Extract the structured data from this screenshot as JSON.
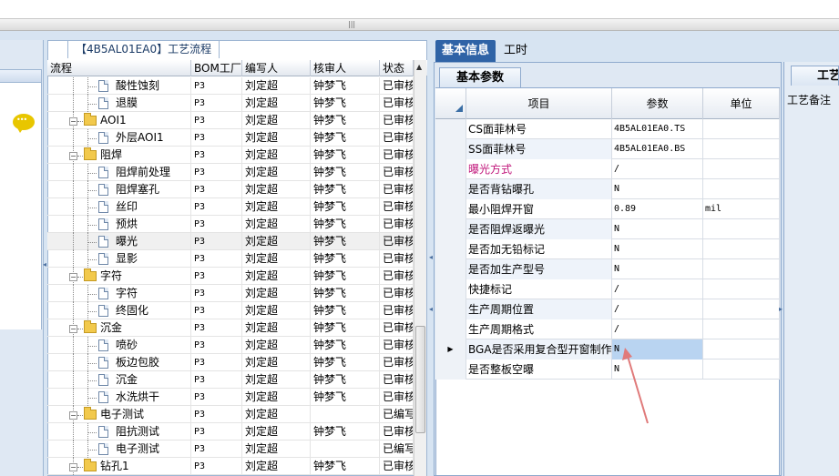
{
  "process_panel": {
    "title": "【4B5AL01EA0】工艺流程",
    "columns": [
      "流程",
      "BOM工厂",
      "编写人",
      "核审人",
      "状态"
    ],
    "rows": [
      {
        "level": 2,
        "type": "file",
        "label": "酸性蚀刻",
        "bom": "P3",
        "writer": "刘定超",
        "reviewer": "钟梦飞",
        "status": "已审核"
      },
      {
        "level": 2,
        "type": "file",
        "label": "退膜",
        "bom": "P3",
        "writer": "刘定超",
        "reviewer": "钟梦飞",
        "status": "已审核"
      },
      {
        "level": 1,
        "type": "folder",
        "label": "AOI1",
        "bom": "P3",
        "writer": "刘定超",
        "reviewer": "钟梦飞",
        "status": "已审核"
      },
      {
        "level": 2,
        "type": "file",
        "label": "外层AOI1",
        "bom": "P3",
        "writer": "刘定超",
        "reviewer": "钟梦飞",
        "status": "已审核"
      },
      {
        "level": 1,
        "type": "folder",
        "label": "阻焊",
        "bom": "P3",
        "writer": "刘定超",
        "reviewer": "钟梦飞",
        "status": "已审核"
      },
      {
        "level": 2,
        "type": "file",
        "label": "阻焊前处理",
        "bom": "P3",
        "writer": "刘定超",
        "reviewer": "钟梦飞",
        "status": "已审核"
      },
      {
        "level": 2,
        "type": "file",
        "label": "阻焊塞孔",
        "bom": "P3",
        "writer": "刘定超",
        "reviewer": "钟梦飞",
        "status": "已审核"
      },
      {
        "level": 2,
        "type": "file",
        "label": "丝印",
        "bom": "P3",
        "writer": "刘定超",
        "reviewer": "钟梦飞",
        "status": "已审核"
      },
      {
        "level": 2,
        "type": "file",
        "label": "预烘",
        "bom": "P3",
        "writer": "刘定超",
        "reviewer": "钟梦飞",
        "status": "已审核"
      },
      {
        "level": 2,
        "type": "file",
        "label": "曝光",
        "bom": "P3",
        "writer": "刘定超",
        "reviewer": "钟梦飞",
        "status": "已审核",
        "selected": true
      },
      {
        "level": 2,
        "type": "file",
        "label": "显影",
        "bom": "P3",
        "writer": "刘定超",
        "reviewer": "钟梦飞",
        "status": "已审核"
      },
      {
        "level": 1,
        "type": "folder",
        "label": "字符",
        "bom": "P3",
        "writer": "刘定超",
        "reviewer": "钟梦飞",
        "status": "已审核"
      },
      {
        "level": 2,
        "type": "file",
        "label": "字符",
        "bom": "P3",
        "writer": "刘定超",
        "reviewer": "钟梦飞",
        "status": "已审核"
      },
      {
        "level": 2,
        "type": "file",
        "label": "终固化",
        "bom": "P3",
        "writer": "刘定超",
        "reviewer": "钟梦飞",
        "status": "已审核"
      },
      {
        "level": 1,
        "type": "folder",
        "label": "沉金",
        "bom": "P3",
        "writer": "刘定超",
        "reviewer": "钟梦飞",
        "status": "已审核"
      },
      {
        "level": 2,
        "type": "file",
        "label": "喷砂",
        "bom": "P3",
        "writer": "刘定超",
        "reviewer": "钟梦飞",
        "status": "已审核"
      },
      {
        "level": 2,
        "type": "file",
        "label": "板边包胶",
        "bom": "P3",
        "writer": "刘定超",
        "reviewer": "钟梦飞",
        "status": "已审核"
      },
      {
        "level": 2,
        "type": "file",
        "label": "沉金",
        "bom": "P3",
        "writer": "刘定超",
        "reviewer": "钟梦飞",
        "status": "已审核"
      },
      {
        "level": 2,
        "type": "file",
        "label": "水洗烘干",
        "bom": "P3",
        "writer": "刘定超",
        "reviewer": "钟梦飞",
        "status": "已审核"
      },
      {
        "level": 1,
        "type": "folder",
        "label": "电子测试",
        "bom": "P3",
        "writer": "刘定超",
        "reviewer": "",
        "status": "已编写"
      },
      {
        "level": 2,
        "type": "file",
        "label": "阻抗测试",
        "bom": "P3",
        "writer": "刘定超",
        "reviewer": "钟梦飞",
        "status": "已审核"
      },
      {
        "level": 2,
        "type": "file",
        "label": "电子测试",
        "bom": "P3",
        "writer": "刘定超",
        "reviewer": "",
        "status": "已编写"
      },
      {
        "level": 1,
        "type": "folder",
        "label": "钻孔1",
        "bom": "P3",
        "writer": "刘定超",
        "reviewer": "钟梦飞",
        "status": "已审核"
      }
    ]
  },
  "tabs": {
    "basic_info": "基本信息",
    "hours": "工时"
  },
  "subtab": "基本参数",
  "prop_grid": {
    "columns": [
      "项目",
      "参数",
      "单位"
    ],
    "rows": [
      {
        "label": "CS面菲林号",
        "value": "4B5AL01EA0.TS",
        "unit": ""
      },
      {
        "label": "SS面菲林号",
        "value": "4B5AL01EA0.BS",
        "unit": ""
      },
      {
        "label": "曝光方式",
        "value": "/",
        "unit": "",
        "color": "#c0157a"
      },
      {
        "label": "是否背钻曝孔",
        "value": "N",
        "unit": ""
      },
      {
        "label": "最小阻焊开窗",
        "value": "0.89",
        "unit": "mil"
      },
      {
        "label": "是否阻焊返曝光",
        "value": "N",
        "unit": ""
      },
      {
        "label": "是否加无铅标记",
        "value": "N",
        "unit": ""
      },
      {
        "label": "是否加生产型号",
        "value": "N",
        "unit": ""
      },
      {
        "label": "快捷标记",
        "value": "/",
        "unit": ""
      },
      {
        "label": "生产周期位置",
        "value": "/",
        "unit": ""
      },
      {
        "label": "生产周期格式",
        "value": "/",
        "unit": ""
      },
      {
        "label": "BGA是否采用复合型开窗制作",
        "value": "N",
        "unit": "",
        "current": true
      },
      {
        "label": "是否整板空曝",
        "value": "N",
        "unit": ""
      }
    ]
  },
  "craft_panel": {
    "tab": "工艺",
    "label": "工艺备注"
  },
  "colors": {
    "accent": "#2f63a6",
    "panel_bg": "#d7e4f2",
    "annotation_arrow": "#e07a7a"
  }
}
